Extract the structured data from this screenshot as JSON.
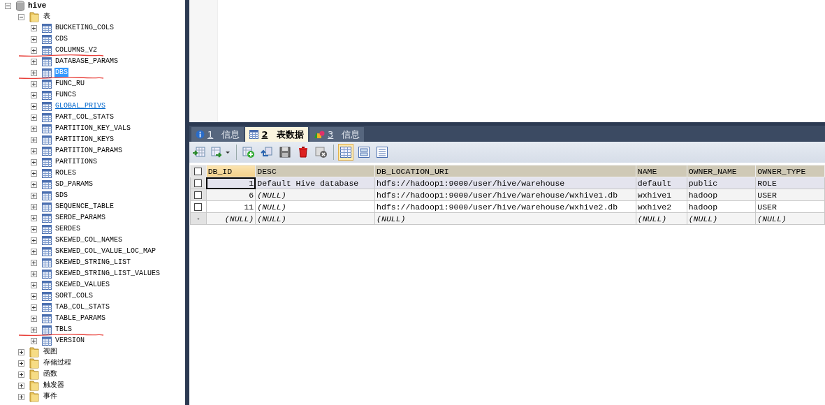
{
  "tree": [
    {
      "label": "hive",
      "kind": "database",
      "expanded": true,
      "children": [
        {
          "label": "表",
          "kind": "folder",
          "expanded": true,
          "children": [
            {
              "label": "BUCKETING_COLS",
              "kind": "table",
              "selected": false,
              "hovered": false,
              "pen_marked": false
            },
            {
              "label": "CDS",
              "kind": "table",
              "selected": false,
              "hovered": false,
              "pen_marked": false
            },
            {
              "label": "COLUMNS_V2",
              "kind": "table",
              "selected": false,
              "hovered": false,
              "pen_marked": true
            },
            {
              "label": "DATABASE_PARAMS",
              "kind": "table",
              "selected": false,
              "hovered": false,
              "pen_marked": false
            },
            {
              "label": "DBS",
              "kind": "table",
              "selected": true,
              "hovered": false,
              "pen_marked": true
            },
            {
              "label": "FUNC_RU",
              "kind": "table",
              "selected": false,
              "hovered": false,
              "pen_marked": false
            },
            {
              "label": "FUNCS",
              "kind": "table",
              "selected": false,
              "hovered": false,
              "pen_marked": false
            },
            {
              "label": "GLOBAL_PRIVS",
              "kind": "table",
              "selected": false,
              "hovered": true,
              "pen_marked": false
            },
            {
              "label": "PART_COL_STATS",
              "kind": "table",
              "selected": false,
              "hovered": false,
              "pen_marked": false
            },
            {
              "label": "PARTITION_KEY_VALS",
              "kind": "table",
              "selected": false,
              "hovered": false,
              "pen_marked": false
            },
            {
              "label": "PARTITION_KEYS",
              "kind": "table",
              "selected": false,
              "hovered": false,
              "pen_marked": false
            },
            {
              "label": "PARTITION_PARAMS",
              "kind": "table",
              "selected": false,
              "hovered": false,
              "pen_marked": false
            },
            {
              "label": "PARTITIONS",
              "kind": "table",
              "selected": false,
              "hovered": false,
              "pen_marked": false
            },
            {
              "label": "ROLES",
              "kind": "table",
              "selected": false,
              "hovered": false,
              "pen_marked": false
            },
            {
              "label": "SD_PARAMS",
              "kind": "table",
              "selected": false,
              "hovered": false,
              "pen_marked": false
            },
            {
              "label": "SDS",
              "kind": "table",
              "selected": false,
              "hovered": false,
              "pen_marked": false
            },
            {
              "label": "SEQUENCE_TABLE",
              "kind": "table",
              "selected": false,
              "hovered": false,
              "pen_marked": false
            },
            {
              "label": "SERDE_PARAMS",
              "kind": "table",
              "selected": false,
              "hovered": false,
              "pen_marked": false
            },
            {
              "label": "SERDES",
              "kind": "table",
              "selected": false,
              "hovered": false,
              "pen_marked": false
            },
            {
              "label": "SKEWED_COL_NAMES",
              "kind": "table",
              "selected": false,
              "hovered": false,
              "pen_marked": false
            },
            {
              "label": "SKEWED_COL_VALUE_LOC_MAP",
              "kind": "table",
              "selected": false,
              "hovered": false,
              "pen_marked": false
            },
            {
              "label": "SKEWED_STRING_LIST",
              "kind": "table",
              "selected": false,
              "hovered": false,
              "pen_marked": false
            },
            {
              "label": "SKEWED_STRING_LIST_VALUES",
              "kind": "table",
              "selected": false,
              "hovered": false,
              "pen_marked": false
            },
            {
              "label": "SKEWED_VALUES",
              "kind": "table",
              "selected": false,
              "hovered": false,
              "pen_marked": false
            },
            {
              "label": "SORT_COLS",
              "kind": "table",
              "selected": false,
              "hovered": false,
              "pen_marked": false
            },
            {
              "label": "TAB_COL_STATS",
              "kind": "table",
              "selected": false,
              "hovered": false,
              "pen_marked": false
            },
            {
              "label": "TABLE_PARAMS",
              "kind": "table",
              "selected": false,
              "hovered": false,
              "pen_marked": false
            },
            {
              "label": "TBLS",
              "kind": "table",
              "selected": false,
              "hovered": false,
              "pen_marked": true
            },
            {
              "label": "VERSION",
              "kind": "table",
              "selected": false,
              "hovered": false,
              "pen_marked": false
            }
          ]
        },
        {
          "label": "视图",
          "kind": "folder",
          "expanded": false
        },
        {
          "label": "存储过程",
          "kind": "folder",
          "expanded": false
        },
        {
          "label": "函数",
          "kind": "folder",
          "expanded": false
        },
        {
          "label": "触发器",
          "kind": "folder",
          "expanded": false
        },
        {
          "label": "事件",
          "kind": "folder",
          "expanded": false
        }
      ]
    }
  ],
  "tabs": [
    {
      "key": "1",
      "label": "信息",
      "kind": "info",
      "selected": false
    },
    {
      "key": "2",
      "label": "表数据",
      "kind": "data",
      "selected": true
    },
    {
      "key": "3",
      "label": "信息",
      "kind": "shapes",
      "selected": false
    }
  ],
  "toolbar": [
    {
      "kind": "insert-row"
    },
    {
      "kind": "import"
    },
    {
      "kind": "separator"
    },
    {
      "kind": "add"
    },
    {
      "kind": "undo"
    },
    {
      "kind": "save"
    },
    {
      "kind": "delete"
    },
    {
      "kind": "cancel"
    }
  ],
  "view_modes": [
    {
      "kind": "grid-view",
      "selected": true
    },
    {
      "kind": "form-view",
      "selected": false
    },
    {
      "kind": "text-view",
      "selected": false
    }
  ],
  "grid": {
    "all_checked": false,
    "columns": [
      "DB_ID",
      "DESC",
      "DB_LOCATION_URI",
      "NAME",
      "OWNER_NAME",
      "OWNER_TYPE"
    ],
    "rows": [
      {
        "kind": "record",
        "selected": true,
        "checked": false,
        "cells": [
          {
            "text": "1",
            "null": false
          },
          {
            "text": "Default Hive database",
            "null": false
          },
          {
            "text": "hdfs://hadoop1:9000/user/hive/warehouse",
            "null": false
          },
          {
            "text": "default",
            "null": false
          },
          {
            "text": "public",
            "null": false
          },
          {
            "text": "ROLE",
            "null": false
          }
        ]
      },
      {
        "kind": "record",
        "selected": false,
        "checked": false,
        "cells": [
          {
            "text": "6",
            "null": false
          },
          {
            "text": "(NULL)",
            "null": true
          },
          {
            "text": "hdfs://hadoop1:9000/user/hive/warehouse/wxhive1.db",
            "null": false
          },
          {
            "text": "wxhive1",
            "null": false
          },
          {
            "text": "hadoop",
            "null": false
          },
          {
            "text": "USER",
            "null": false
          }
        ]
      },
      {
        "kind": "record",
        "selected": false,
        "checked": false,
        "cells": [
          {
            "text": "11",
            "null": false
          },
          {
            "text": "(NULL)",
            "null": true
          },
          {
            "text": "hdfs://hadoop1:9000/user/hive/warehouse/wxhive2.db",
            "null": false
          },
          {
            "text": "wxhive2",
            "null": false
          },
          {
            "text": "hadoop",
            "null": false
          },
          {
            "text": "USER",
            "null": false
          }
        ]
      },
      {
        "kind": "new",
        "marker": "*",
        "selected": false,
        "cells": [
          {
            "text": "(NULL)",
            "null": true
          },
          {
            "text": "(NULL)",
            "null": true
          },
          {
            "text": "(NULL)",
            "null": true
          },
          {
            "text": "(NULL)",
            "null": true
          },
          {
            "text": "(NULL)",
            "null": true
          },
          {
            "text": "(NULL)",
            "null": true
          }
        ]
      }
    ]
  }
}
